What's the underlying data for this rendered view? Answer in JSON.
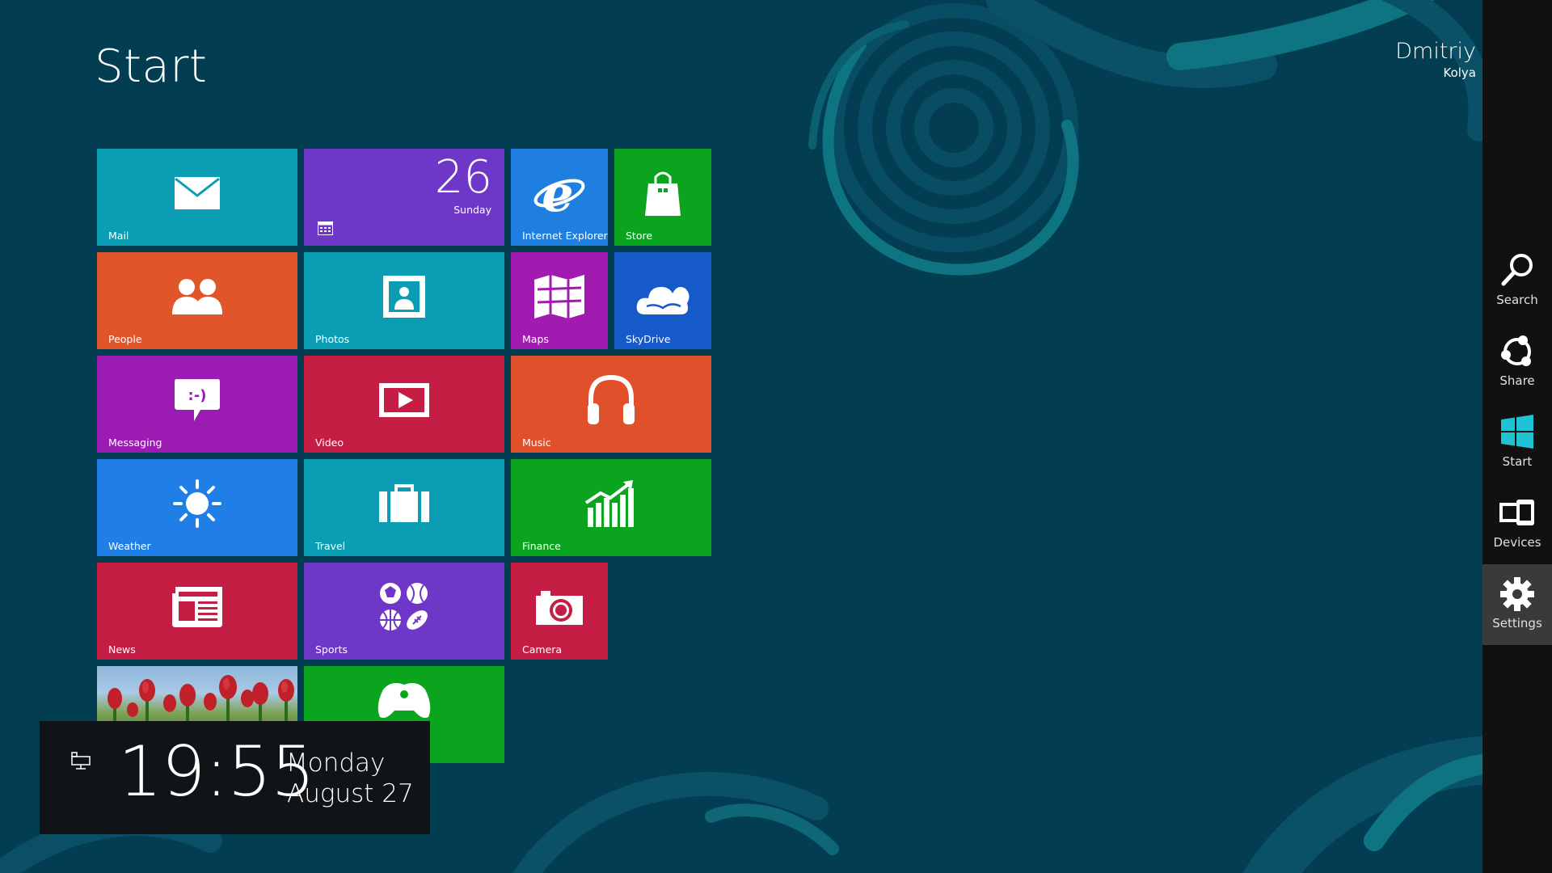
{
  "screen": {
    "title": "Start",
    "user": {
      "name": "Dmitriy",
      "account": "Kolya"
    }
  },
  "tiles": {
    "mail": {
      "label": "Mail",
      "color": "#0a9db4",
      "icon": "mail-icon"
    },
    "calendar": {
      "day_number": "26",
      "weekday": "Sunday",
      "color": "#6f37c8",
      "icon": "calendar-icon"
    },
    "ie": {
      "label": "Internet Explorer",
      "color": "#1e7fe0",
      "icon": "internet-explorer-icon"
    },
    "store": {
      "label": "Store",
      "color": "#0aa41e",
      "icon": "shopping-bag-icon"
    },
    "people": {
      "label": "People",
      "color": "#e0562a",
      "icon": "people-icon"
    },
    "photos": {
      "label": "Photos",
      "color": "#0a9db4",
      "icon": "photo-icon"
    },
    "maps": {
      "label": "Maps",
      "color": "#a21bb0",
      "icon": "map-icon"
    },
    "skydrive": {
      "label": "SkyDrive",
      "color": "#1659c9",
      "icon": "cloud-icon"
    },
    "messaging": {
      "label": "Messaging",
      "color": "#9c1bb3",
      "icon": "message-bubble-icon"
    },
    "video": {
      "label": "Video",
      "color": "#c41e45",
      "icon": "video-play-icon"
    },
    "music": {
      "label": "Music",
      "color": "#e0502a",
      "icon": "headphones-icon"
    },
    "weather": {
      "label": "Weather",
      "color": "#1f7fe6",
      "icon": "sun-icon"
    },
    "travel": {
      "label": "Travel",
      "color": "#0a9db4",
      "icon": "suitcase-icon"
    },
    "finance": {
      "label": "Finance",
      "color": "#0aa41e",
      "icon": "stock-chart-icon"
    },
    "news": {
      "label": "News",
      "color": "#c41e45",
      "icon": "newspaper-icon"
    },
    "sports": {
      "label": "Sports",
      "color": "#6f37c8",
      "icon": "sports-balls-icon"
    },
    "camera": {
      "label": "Camera",
      "color": "#c41e45",
      "icon": "camera-icon"
    },
    "desktop": {
      "icon": "tulip-photo"
    },
    "xbox": {
      "color": "#0aa41e",
      "icon": "game-controller-icon"
    }
  },
  "lock_clock": {
    "time": "19:55",
    "weekday": "Monday",
    "date": "August 27",
    "icon": "network-icon"
  },
  "charms": [
    {
      "label": "Search",
      "icon": "search-icon"
    },
    {
      "label": "Share",
      "icon": "share-icon"
    },
    {
      "label": "Start",
      "icon": "windows-logo-icon",
      "accent": "#1ec4d6"
    },
    {
      "label": "Devices",
      "icon": "devices-icon"
    },
    {
      "label": "Settings",
      "icon": "gear-icon",
      "active": true
    }
  ],
  "colors": {
    "background": "#033d52",
    "charm_bar": "#111111"
  }
}
